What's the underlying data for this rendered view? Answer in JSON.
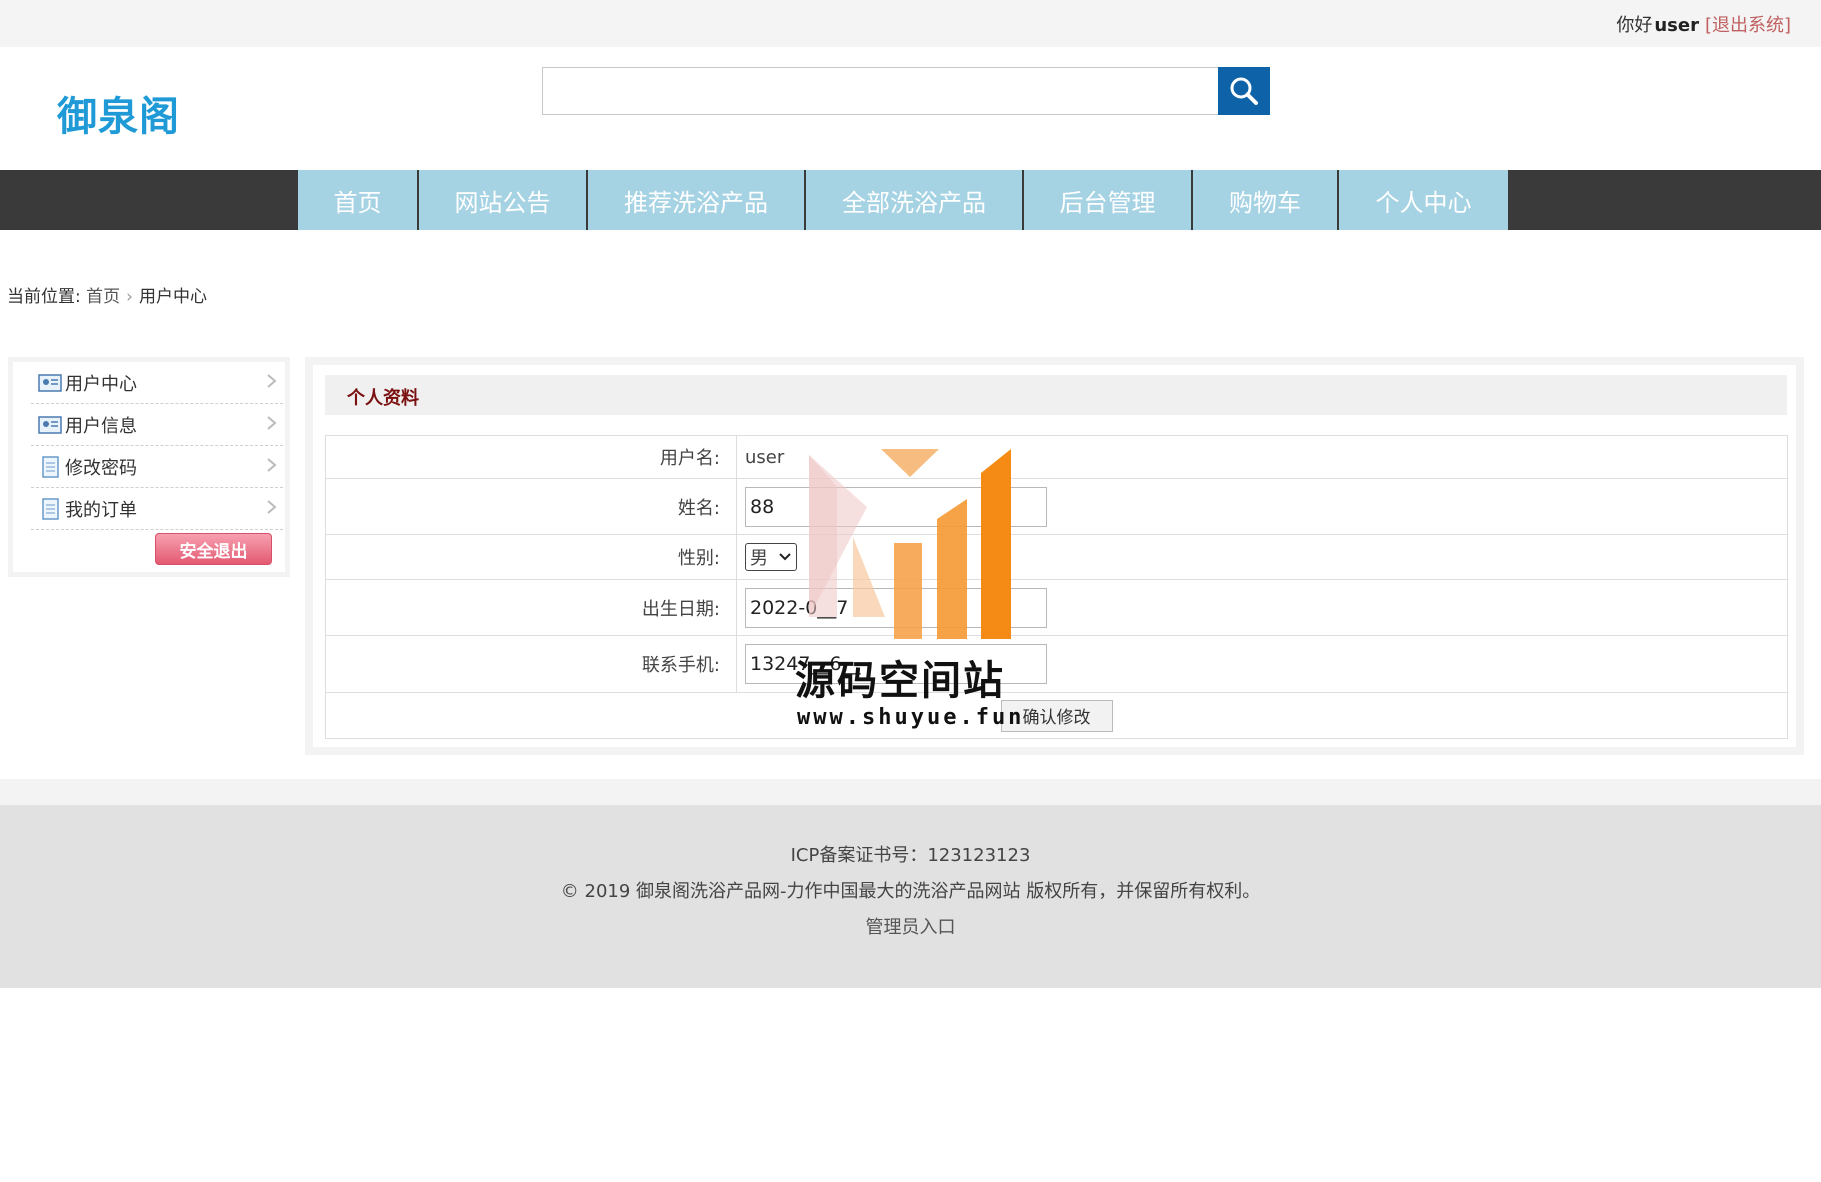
{
  "topbar": {
    "greeting": "你好",
    "username": "user",
    "logout_label": "[退出系统]"
  },
  "header": {
    "logo_text": "御泉阁",
    "search": {
      "value": "",
      "placeholder": ""
    }
  },
  "nav": {
    "items": [
      "首页",
      "网站公告",
      "推荐洗浴产品",
      "全部洗浴产品",
      "后台管理",
      "购物车",
      "个人中心"
    ]
  },
  "breadcrumb": {
    "prefix": "当前位置:",
    "home": "首页",
    "current": "用户中心"
  },
  "sidebar": {
    "items": [
      {
        "label": "用户中心",
        "icon": "id-card-icon"
      },
      {
        "label": "用户信息",
        "icon": "id-card-icon"
      },
      {
        "label": "修改密码",
        "icon": "document-icon"
      },
      {
        "label": "我的订单",
        "icon": "document-icon"
      }
    ],
    "exit_label": "安全退出"
  },
  "profile": {
    "title": "个人资料",
    "username_label": "用户名:",
    "username_value": "user",
    "name_label": "姓名:",
    "name_value": "88",
    "gender_label": "性别:",
    "gender_value": "男",
    "birth_label": "出生日期:",
    "birth_value": "2022-0__7",
    "phone_label": "联系手机:",
    "phone_value": "13247__6__",
    "submit_label": "确认修改"
  },
  "footer": {
    "icp": "ICP备案证书号：123123123",
    "copyright": "© 2019 御泉阁洗浴产品网-力作中国最大的洗浴产品网站 版权所有，并保留所有权利。",
    "admin_link": "管理员入口"
  },
  "watermark": {
    "text": "源码空间站",
    "url": "www.shuyue.fun"
  },
  "colors": {
    "accent": "#1f9ad6",
    "nav_item": "#a6d3e3",
    "nav_bg": "#3a3a3a",
    "search_btn": "#0d62a8",
    "panel_title": "#7a1010"
  }
}
